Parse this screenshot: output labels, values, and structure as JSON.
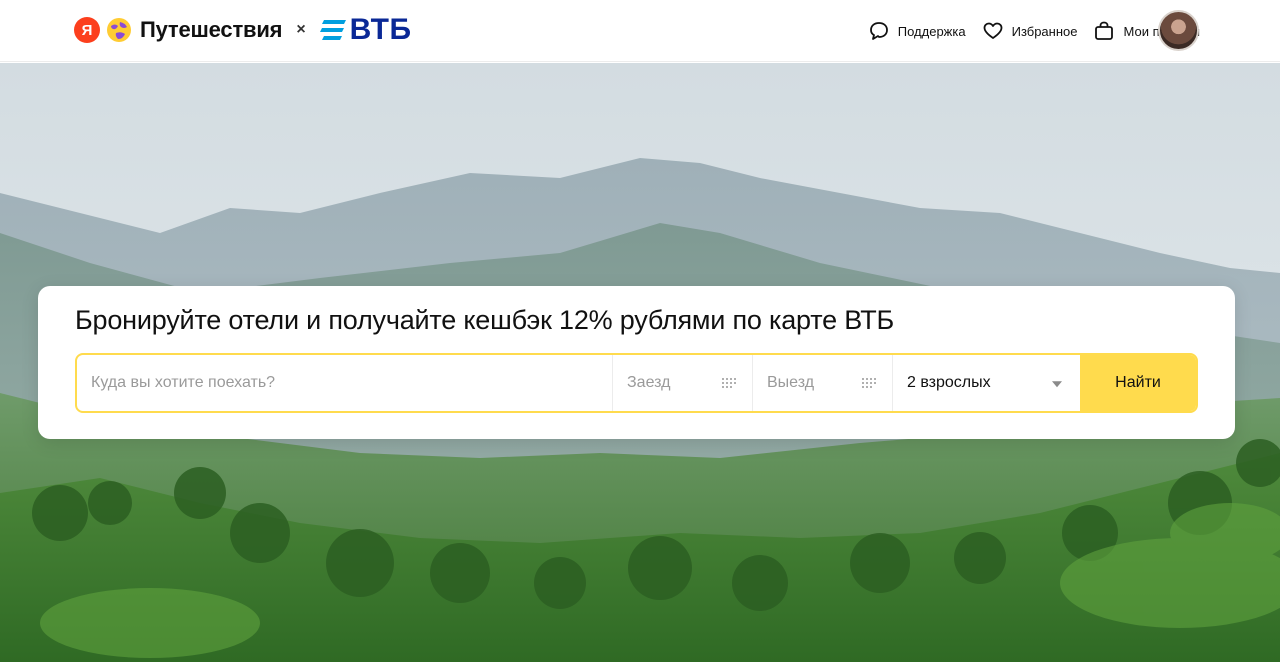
{
  "header": {
    "logo_letter": "Я",
    "brand_name": "Путешествия",
    "separator": "×",
    "partner": "ВТБ",
    "nav": [
      {
        "icon": "chat-bubble-icon",
        "label": "Поддержка"
      },
      {
        "icon": "heart-icon",
        "label": "Избранное"
      },
      {
        "icon": "bag-icon",
        "label": "Мои поездки"
      }
    ]
  },
  "search": {
    "title": "Бронируйте отели и получайте кешбэк 12% рублями по карте ВТБ",
    "destination_placeholder": "Куда вы хотите поехать?",
    "checkin_placeholder": "Заезд",
    "checkout_placeholder": "Выезд",
    "guests_value": "2 взрослых",
    "submit_label": "Найти"
  },
  "colors": {
    "accent": "#ffdb4d",
    "yandex_red": "#fc3f1d",
    "vtb_blue": "#0a2896"
  }
}
